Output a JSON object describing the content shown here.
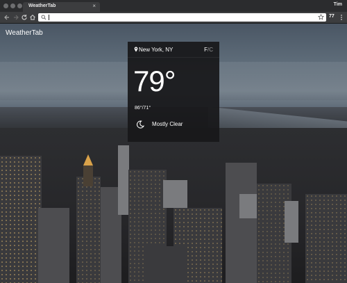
{
  "browser": {
    "tab_title": "WeatherTab",
    "tab_close": "×",
    "profile_name": "Tim",
    "omnibox": {
      "value": "",
      "placeholder": ""
    },
    "extension_badge": "77"
  },
  "page": {
    "brand": "WeatherTab"
  },
  "weather": {
    "location": "New York, NY",
    "unit_f": "F",
    "unit_sep": "/",
    "unit_c": "C",
    "temperature": "79°",
    "hi_lo": "86°/71°",
    "condition": "Mostly Clear",
    "condition_icon": "moon-icon"
  },
  "colors": {
    "card_bg": "#18181a",
    "text": "#ffffff",
    "unit_inactive": "#9a9a9a"
  }
}
